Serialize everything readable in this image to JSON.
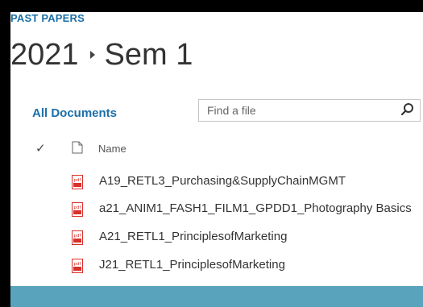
{
  "breadcrumb": {
    "site": "PAST PAPERS"
  },
  "title": {
    "year": "2021",
    "folder": "Sem 1"
  },
  "view": {
    "label": "All Documents"
  },
  "search": {
    "placeholder": "Find a file"
  },
  "list": {
    "column_name": "Name",
    "files": [
      {
        "name": "A19_RETL3_Purchasing&SupplyChainMGMT",
        "icon": "pdf-icon"
      },
      {
        "name": "a21_ANIM1_FASH1_FILM1_GPDD1_Photography Basics",
        "icon": "pdf-icon"
      },
      {
        "name": "A21_RETL1_PrinciplesofMarketing",
        "icon": "pdf-icon"
      },
      {
        "name": "J21_RETL1_PrinciplesofMarketing",
        "icon": "pdf-icon"
      }
    ]
  },
  "colors": {
    "accent": "#1a6fa8",
    "pdf": "#d9302c",
    "frame": "#5aa3bc"
  }
}
